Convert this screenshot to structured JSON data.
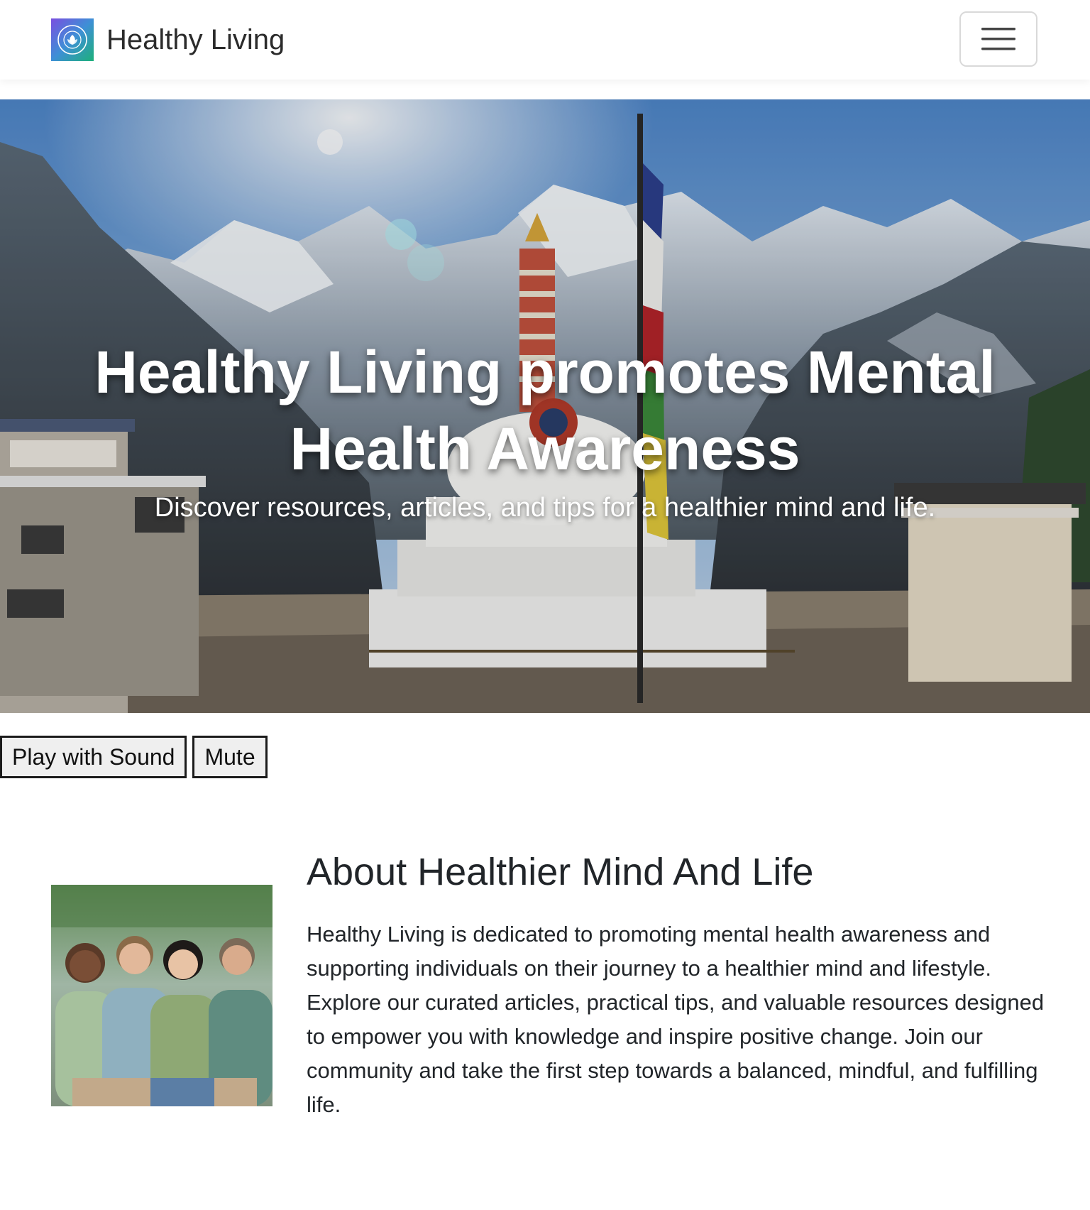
{
  "navbar": {
    "brand_name": "Healthy Living",
    "logo_text": "HEALTHY LIVING",
    "menu_icon": "hamburger-menu-icon"
  },
  "hero": {
    "title": "Healthy Living promotes Mental Health Awareness",
    "subtitle": "Discover resources, articles, and tips for a healthier mind and life."
  },
  "video_controls": {
    "play_label": "Play with Sound",
    "mute_label": "Mute"
  },
  "about": {
    "title": "About Healthier Mind And Life",
    "body": "Healthy Living is dedicated to promoting mental health awareness and supporting individuals on their journey to a healthier mind and lifestyle. Explore our curated articles, practical tips, and valuable resources designed to empower you with knowledge and inspire positive change. Join our community and take the first step towards a balanced, mindful, and fulfilling life."
  },
  "colors": {
    "logo_gradient_start": "#7a4fe0",
    "logo_gradient_end": "#1db07a",
    "hero_text": "#ffffff",
    "body_text": "#212529"
  }
}
